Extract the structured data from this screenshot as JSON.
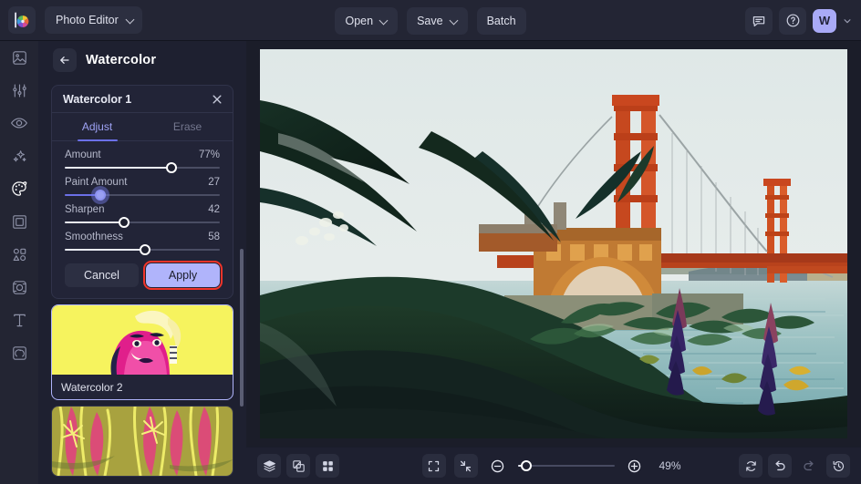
{
  "header": {
    "logo": "colorwheel-logo",
    "app_menu_label": "Photo Editor",
    "buttons": [
      {
        "label": "Open",
        "caret": true,
        "name": "open-button"
      },
      {
        "label": "Save",
        "caret": true,
        "name": "save-button"
      },
      {
        "label": "Batch",
        "caret": false,
        "name": "batch-button"
      }
    ],
    "feedback_icon": "comment-icon",
    "help_icon": "question-circle-icon",
    "avatar_initial": "W"
  },
  "sidebar": {
    "items": [
      {
        "name": "sidebar-item-image",
        "icon": "image-icon",
        "active": false
      },
      {
        "name": "sidebar-item-adjust",
        "icon": "sliders-icon",
        "active": false
      },
      {
        "name": "sidebar-item-retouch",
        "icon": "eye-icon",
        "active": false
      },
      {
        "name": "sidebar-item-effects",
        "icon": "sparkles-icon",
        "active": false
      },
      {
        "name": "sidebar-item-artistic",
        "icon": "palette-icon",
        "active": true
      },
      {
        "name": "sidebar-item-frame",
        "icon": "frame-icon",
        "active": false
      },
      {
        "name": "sidebar-item-shapes",
        "icon": "shapes-icon",
        "active": false
      },
      {
        "name": "sidebar-item-focus",
        "icon": "focus-icon",
        "active": false
      },
      {
        "name": "sidebar-item-text",
        "icon": "text-icon",
        "active": false
      },
      {
        "name": "sidebar-item-layers",
        "icon": "layers-stack-icon",
        "active": false
      }
    ]
  },
  "panel": {
    "back_icon": "arrow-left-icon",
    "title": "Watercolor",
    "card": {
      "title": "Watercolor 1",
      "close_icon": "close-icon",
      "tabs": [
        {
          "label": "Adjust",
          "active": true
        },
        {
          "label": "Erase",
          "active": false
        }
      ],
      "sliders": [
        {
          "label": "Amount",
          "value": "77%",
          "percent": 69,
          "focused": false
        },
        {
          "label": "Paint Amount",
          "value": "27",
          "percent": 23,
          "focused": true
        },
        {
          "label": "Sharpen",
          "value": "42",
          "percent": 38,
          "focused": false
        },
        {
          "label": "Smoothness",
          "value": "58",
          "percent": 52,
          "focused": false
        }
      ],
      "cancel_label": "Cancel",
      "apply_label": "Apply"
    },
    "presets": [
      {
        "name": "Watercolor 2",
        "selected": true,
        "style": "portrait-yellow-magenta"
      },
      {
        "name": "",
        "selected": false,
        "style": "floral-pink-olive"
      }
    ]
  },
  "bottombar": {
    "left_tools": [
      {
        "name": "layers-button",
        "icon": "layers-stack-icon"
      },
      {
        "name": "compare-button",
        "icon": "compare-split-icon"
      },
      {
        "name": "grid-button",
        "icon": "grid-four-icon"
      }
    ],
    "view_tools": [
      {
        "name": "fit-to-screen-button",
        "icon": "expand-corners-icon"
      },
      {
        "name": "actual-size-button",
        "icon": "collapse-arrows-icon"
      }
    ],
    "zoom_out_icon": "minus-circle-icon",
    "zoom_in_icon": "plus-circle-icon",
    "zoom_level": "49%",
    "zoom_percent": 9,
    "right_tools": [
      {
        "name": "reset-button",
        "icon": "refresh-icon",
        "enabled": true
      },
      {
        "name": "undo-button",
        "icon": "undo-arrow-icon",
        "enabled": true
      },
      {
        "name": "redo-button",
        "icon": "redo-arrow-icon",
        "enabled": false
      },
      {
        "name": "history-button",
        "icon": "clock-history-icon",
        "enabled": true
      }
    ]
  },
  "canvas": {
    "image_description": "Watercolor-styled photo of the Golden Gate Bridge seen past dark green foliage and purple lupine flowers over teal water",
    "colors": {
      "sky": "#e2e9e8",
      "bridge_red": "#c9471f",
      "foliage_dark": "#14291d",
      "water_teal": "#7fb3b6",
      "lupine_purple": "#3b2a72"
    }
  },
  "theme": {
    "bg": "#1b1d29",
    "panel_bg": "#1e2030",
    "header_bg": "#232534",
    "accent": "#6b70e8",
    "accent_light": "#b0b4fb",
    "highlight_outline": "#f1342a"
  }
}
